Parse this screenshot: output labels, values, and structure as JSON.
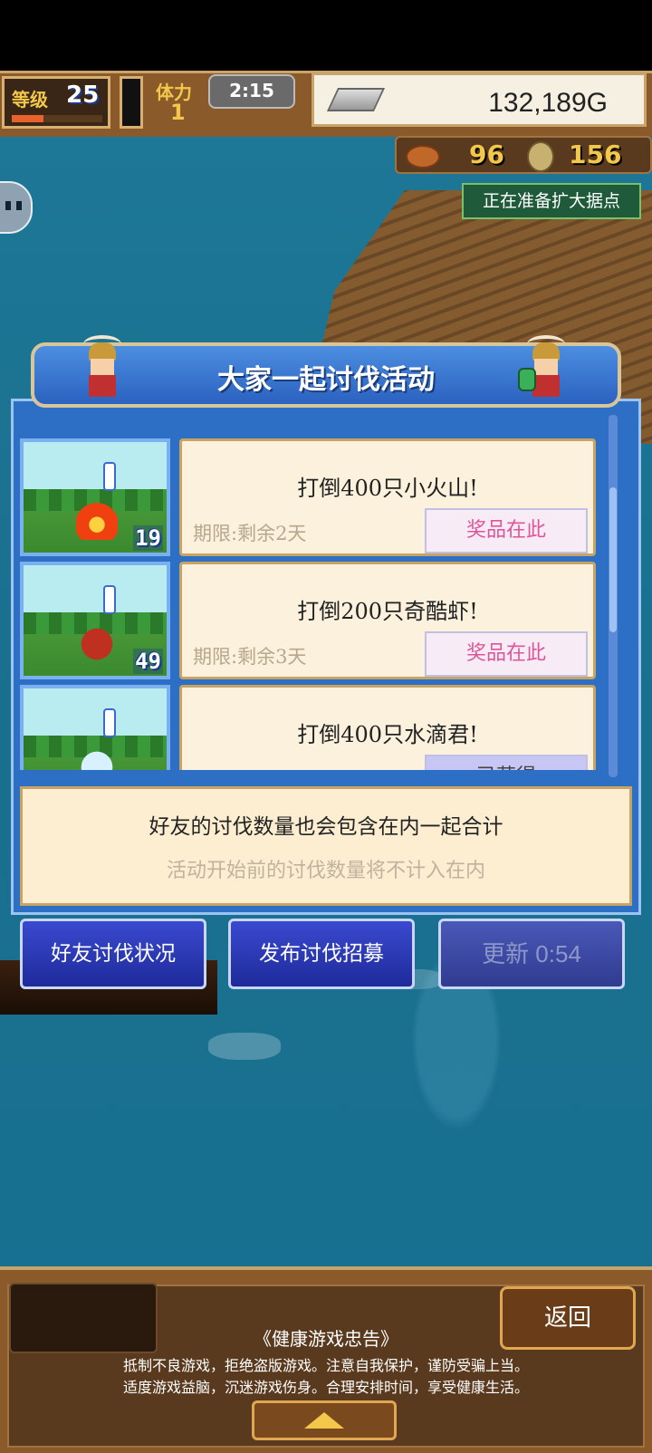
{
  "status": {
    "level_label": "等级",
    "level": "25",
    "level_progress": 0.35,
    "stamina_label": "体力",
    "stamina": "1",
    "timer": "2:15",
    "gold": "132,189G"
  },
  "resources": {
    "food": "96",
    "coins": "156"
  },
  "notice_tag": "正在准备扩大据点",
  "panel": {
    "title": "大家一起讨伐活动",
    "missions": [
      {
        "title": "打倒400只小火山!",
        "deadline": "期限:剩余2天",
        "prize": "奖品在此",
        "count": "19",
        "monster": "fire"
      },
      {
        "title": "打倒200只奇酷虾!",
        "deadline": "期限:剩余3天",
        "prize": "奖品在此",
        "count": "49",
        "monster": "shrimp"
      },
      {
        "title": "打倒400只水滴君!",
        "deadline": "",
        "prize": "已获得",
        "count": "",
        "monster": "drop"
      }
    ],
    "info_line1": "好友的讨伐数量也会包含在内一起合计",
    "info_line2": "活动开始前的讨伐数量将不计入在内"
  },
  "buttons": {
    "friend_status": "好友讨伐状况",
    "publish_recruit": "发布讨伐招募",
    "refresh": "更新 0:54"
  },
  "footer": {
    "back": "返回",
    "notice_title": "《健康游戏忠告》",
    "notice_line1": "抵制不良游戏，拒绝盗版游戏。注意自我保护，谨防受骗上当。",
    "notice_line2": "适度游戏益脑，沉迷游戏伤身。合理安排时间，享受健康生活。"
  }
}
